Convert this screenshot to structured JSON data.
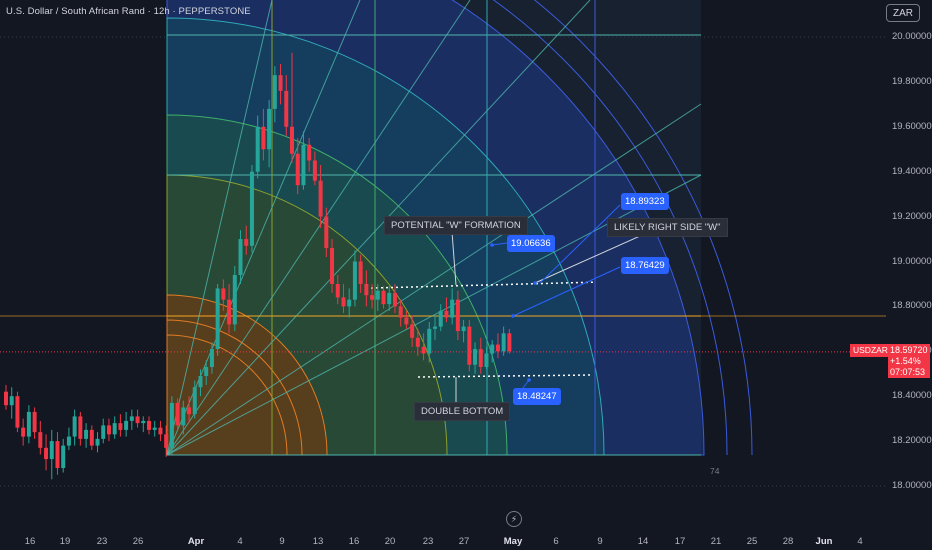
{
  "header": {
    "title": "U.S. Dollar / South African Rand · 12h · PEPPERSTONE",
    "currency_button": "ZAR"
  },
  "chart_data": {
    "type": "candlestick",
    "symbol": "USDZAR",
    "ylim": [
      18.0,
      20.08
    ],
    "y_ticks": [
      "20.00000",
      "19.80000",
      "19.60000",
      "19.40000",
      "19.20000",
      "19.00000",
      "18.80000",
      "18.60000",
      "18.40000",
      "18.20000",
      "18.00000"
    ],
    "x_ticks": [
      "16",
      "19",
      "23",
      "26",
      "Apr",
      "4",
      "9",
      "13",
      "16",
      "20",
      "23",
      "27",
      "May",
      "6",
      "9",
      "14",
      "17",
      "21",
      "25",
      "28",
      "Jun",
      "4"
    ],
    "current_price": {
      "label": "USDZAR",
      "price": "18.59720",
      "change": "+1.54%",
      "countdown": "07:07:53"
    },
    "annotations": {
      "potential_w": "POTENTIAL \"W\" FORMATION",
      "likely_right": "LIKELY RIGHT SIDE \"W\"",
      "double_bottom": "DOUBLE BOTTOM",
      "price_19_06": "19.06636",
      "price_18_89": "18.89323",
      "price_18_76": "18.76429",
      "price_18_48": "18.48247",
      "bar_count": "74"
    },
    "levels": {
      "resistance_dotted": 18.89,
      "support_dotted": 18.49,
      "horizontal_mid": 18.76
    },
    "candles": [
      {
        "o": 18.42,
        "h": 18.45,
        "l": 18.34,
        "c": 18.36
      },
      {
        "o": 18.36,
        "h": 18.44,
        "l": 18.3,
        "c": 18.4
      },
      {
        "o": 18.4,
        "h": 18.42,
        "l": 18.24,
        "c": 18.26
      },
      {
        "o": 18.26,
        "h": 18.3,
        "l": 18.18,
        "c": 18.22
      },
      {
        "o": 18.22,
        "h": 18.36,
        "l": 18.19,
        "c": 18.33
      },
      {
        "o": 18.33,
        "h": 18.35,
        "l": 18.21,
        "c": 18.24
      },
      {
        "o": 18.24,
        "h": 18.29,
        "l": 18.14,
        "c": 18.17
      },
      {
        "o": 18.17,
        "h": 18.23,
        "l": 18.07,
        "c": 18.12
      },
      {
        "o": 18.12,
        "h": 18.25,
        "l": 18.03,
        "c": 18.2
      },
      {
        "o": 18.2,
        "h": 18.24,
        "l": 18.05,
        "c": 18.08
      },
      {
        "o": 18.08,
        "h": 18.21,
        "l": 18.06,
        "c": 18.18
      },
      {
        "o": 18.18,
        "h": 18.26,
        "l": 18.16,
        "c": 18.22
      },
      {
        "o": 18.22,
        "h": 18.34,
        "l": 18.18,
        "c": 18.31
      },
      {
        "o": 18.31,
        "h": 18.33,
        "l": 18.18,
        "c": 18.21
      },
      {
        "o": 18.21,
        "h": 18.28,
        "l": 18.17,
        "c": 18.25
      },
      {
        "o": 18.25,
        "h": 18.27,
        "l": 18.16,
        "c": 18.18
      },
      {
        "o": 18.18,
        "h": 18.24,
        "l": 18.15,
        "c": 18.21
      },
      {
        "o": 18.21,
        "h": 18.3,
        "l": 18.19,
        "c": 18.27
      },
      {
        "o": 18.27,
        "h": 18.3,
        "l": 18.2,
        "c": 18.23
      },
      {
        "o": 18.23,
        "h": 18.31,
        "l": 18.21,
        "c": 18.28
      },
      {
        "o": 18.28,
        "h": 18.32,
        "l": 18.22,
        "c": 18.25
      },
      {
        "o": 18.25,
        "h": 18.33,
        "l": 18.22,
        "c": 18.29
      },
      {
        "o": 18.29,
        "h": 18.34,
        "l": 18.25,
        "c": 18.31
      },
      {
        "o": 18.31,
        "h": 18.34,
        "l": 18.26,
        "c": 18.28
      },
      {
        "o": 18.28,
        "h": 18.31,
        "l": 18.24,
        "c": 18.29
      },
      {
        "o": 18.29,
        "h": 18.31,
        "l": 18.23,
        "c": 18.25
      },
      {
        "o": 18.25,
        "h": 18.29,
        "l": 18.22,
        "c": 18.26
      },
      {
        "o": 18.26,
        "h": 18.29,
        "l": 18.2,
        "c": 18.23
      },
      {
        "o": 18.23,
        "h": 18.27,
        "l": 18.13,
        "c": 18.17
      },
      {
        "o": 18.17,
        "h": 18.4,
        "l": 18.14,
        "c": 18.37
      },
      {
        "o": 18.37,
        "h": 18.39,
        "l": 18.25,
        "c": 18.27
      },
      {
        "o": 18.27,
        "h": 18.38,
        "l": 18.23,
        "c": 18.35
      },
      {
        "o": 18.35,
        "h": 18.4,
        "l": 18.28,
        "c": 18.32
      },
      {
        "o": 18.32,
        "h": 18.47,
        "l": 18.3,
        "c": 18.44
      },
      {
        "o": 18.44,
        "h": 18.52,
        "l": 18.4,
        "c": 18.49
      },
      {
        "o": 18.49,
        "h": 18.56,
        "l": 18.45,
        "c": 18.53
      },
      {
        "o": 18.53,
        "h": 18.64,
        "l": 18.5,
        "c": 18.61
      },
      {
        "o": 18.61,
        "h": 18.9,
        "l": 18.58,
        "c": 18.88
      },
      {
        "o": 18.88,
        "h": 18.92,
        "l": 18.78,
        "c": 18.83
      },
      {
        "o": 18.83,
        "h": 18.9,
        "l": 18.68,
        "c": 18.72
      },
      {
        "o": 18.72,
        "h": 18.98,
        "l": 18.69,
        "c": 18.94
      },
      {
        "o": 18.94,
        "h": 19.14,
        "l": 18.9,
        "c": 19.1
      },
      {
        "o": 19.1,
        "h": 19.16,
        "l": 19.03,
        "c": 19.07
      },
      {
        "o": 19.07,
        "h": 19.43,
        "l": 19.04,
        "c": 19.4
      },
      {
        "o": 19.4,
        "h": 19.65,
        "l": 19.37,
        "c": 19.6
      },
      {
        "o": 19.6,
        "h": 19.68,
        "l": 19.45,
        "c": 19.5
      },
      {
        "o": 19.5,
        "h": 19.72,
        "l": 19.42,
        "c": 19.68
      },
      {
        "o": 19.68,
        "h": 19.87,
        "l": 19.62,
        "c": 19.83
      },
      {
        "o": 19.83,
        "h": 19.88,
        "l": 19.7,
        "c": 19.76
      },
      {
        "o": 19.76,
        "h": 19.83,
        "l": 19.56,
        "c": 19.6
      },
      {
        "o": 19.6,
        "h": 19.93,
        "l": 19.44,
        "c": 19.48
      },
      {
        "o": 19.48,
        "h": 19.55,
        "l": 19.3,
        "c": 19.34
      },
      {
        "o": 19.34,
        "h": 19.58,
        "l": 19.32,
        "c": 19.52
      },
      {
        "o": 19.52,
        "h": 19.55,
        "l": 19.4,
        "c": 19.45
      },
      {
        "o": 19.45,
        "h": 19.49,
        "l": 19.34,
        "c": 19.36
      },
      {
        "o": 19.36,
        "h": 19.43,
        "l": 19.15,
        "c": 19.2
      },
      {
        "o": 19.2,
        "h": 19.24,
        "l": 19.02,
        "c": 19.06
      },
      {
        "o": 19.06,
        "h": 19.1,
        "l": 18.86,
        "c": 18.9
      },
      {
        "o": 18.9,
        "h": 18.94,
        "l": 18.81,
        "c": 18.84
      },
      {
        "o": 18.84,
        "h": 18.9,
        "l": 18.77,
        "c": 18.8
      },
      {
        "o": 18.8,
        "h": 18.88,
        "l": 18.75,
        "c": 18.83
      },
      {
        "o": 18.83,
        "h": 19.05,
        "l": 18.8,
        "c": 19.0
      },
      {
        "o": 19.0,
        "h": 19.03,
        "l": 18.86,
        "c": 18.9
      },
      {
        "o": 18.9,
        "h": 18.96,
        "l": 18.8,
        "c": 18.85
      },
      {
        "o": 18.85,
        "h": 18.9,
        "l": 18.79,
        "c": 18.83
      },
      {
        "o": 18.83,
        "h": 18.9,
        "l": 18.78,
        "c": 18.87
      },
      {
        "o": 18.87,
        "h": 18.89,
        "l": 18.79,
        "c": 18.81
      },
      {
        "o": 18.81,
        "h": 18.89,
        "l": 18.78,
        "c": 18.86
      },
      {
        "o": 18.86,
        "h": 18.9,
        "l": 18.77,
        "c": 18.8
      },
      {
        "o": 18.8,
        "h": 18.83,
        "l": 18.71,
        "c": 18.75
      },
      {
        "o": 18.75,
        "h": 18.78,
        "l": 18.7,
        "c": 18.72
      },
      {
        "o": 18.72,
        "h": 18.76,
        "l": 18.62,
        "c": 18.66
      },
      {
        "o": 18.66,
        "h": 18.7,
        "l": 18.58,
        "c": 18.62
      },
      {
        "o": 18.62,
        "h": 18.68,
        "l": 18.56,
        "c": 18.59
      },
      {
        "o": 18.59,
        "h": 18.73,
        "l": 18.55,
        "c": 18.7
      },
      {
        "o": 18.7,
        "h": 18.76,
        "l": 18.65,
        "c": 18.71
      },
      {
        "o": 18.71,
        "h": 18.81,
        "l": 18.69,
        "c": 18.78
      },
      {
        "o": 18.78,
        "h": 18.84,
        "l": 18.73,
        "c": 18.75
      },
      {
        "o": 18.75,
        "h": 18.88,
        "l": 18.72,
        "c": 18.83
      },
      {
        "o": 18.83,
        "h": 18.87,
        "l": 18.65,
        "c": 18.69
      },
      {
        "o": 18.69,
        "h": 18.74,
        "l": 18.64,
        "c": 18.71
      },
      {
        "o": 18.71,
        "h": 18.74,
        "l": 18.51,
        "c": 18.54
      },
      {
        "o": 18.54,
        "h": 18.64,
        "l": 18.5,
        "c": 18.61
      },
      {
        "o": 18.61,
        "h": 18.66,
        "l": 18.5,
        "c": 18.53
      },
      {
        "o": 18.53,
        "h": 18.62,
        "l": 18.52,
        "c": 18.59
      },
      {
        "o": 18.59,
        "h": 18.65,
        "l": 18.55,
        "c": 18.63
      },
      {
        "o": 18.63,
        "h": 18.68,
        "l": 18.57,
        "c": 18.6
      },
      {
        "o": 18.6,
        "h": 18.71,
        "l": 18.58,
        "c": 18.68
      },
      {
        "o": 18.68,
        "h": 18.7,
        "l": 18.59,
        "c": 18.6
      }
    ]
  },
  "colors": {
    "background": "#131722",
    "up": "#26a69a",
    "down": "#f23645",
    "annotation_blue": "#2962ff"
  }
}
